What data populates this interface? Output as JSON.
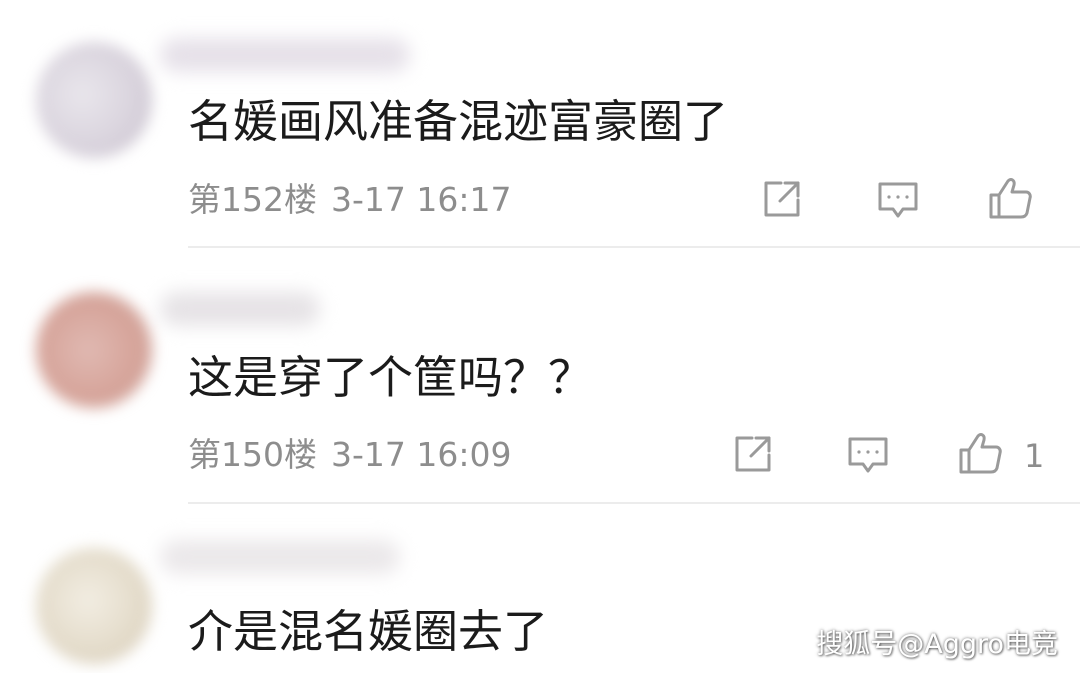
{
  "comments": [
    {
      "content": "名媛画风准备混迹富豪圈了",
      "floor": "第152楼",
      "time": "3-17 16:17",
      "like_count": ""
    },
    {
      "content": "这是穿了个筐吗？？",
      "floor": "第150楼",
      "time": "3-17 16:09",
      "like_count": "1"
    },
    {
      "content": "介是混名媛圈去了"
    }
  ],
  "icons": {
    "share": "share-icon",
    "reply": "comment-icon",
    "like": "thumbs-up-icon"
  },
  "colors": {
    "text": "#1b1b1b",
    "meta": "#8d8d8d",
    "icon": "#9a9a9a",
    "divider": "#ececec"
  },
  "watermark": "搜狐号@Aggro电竞"
}
